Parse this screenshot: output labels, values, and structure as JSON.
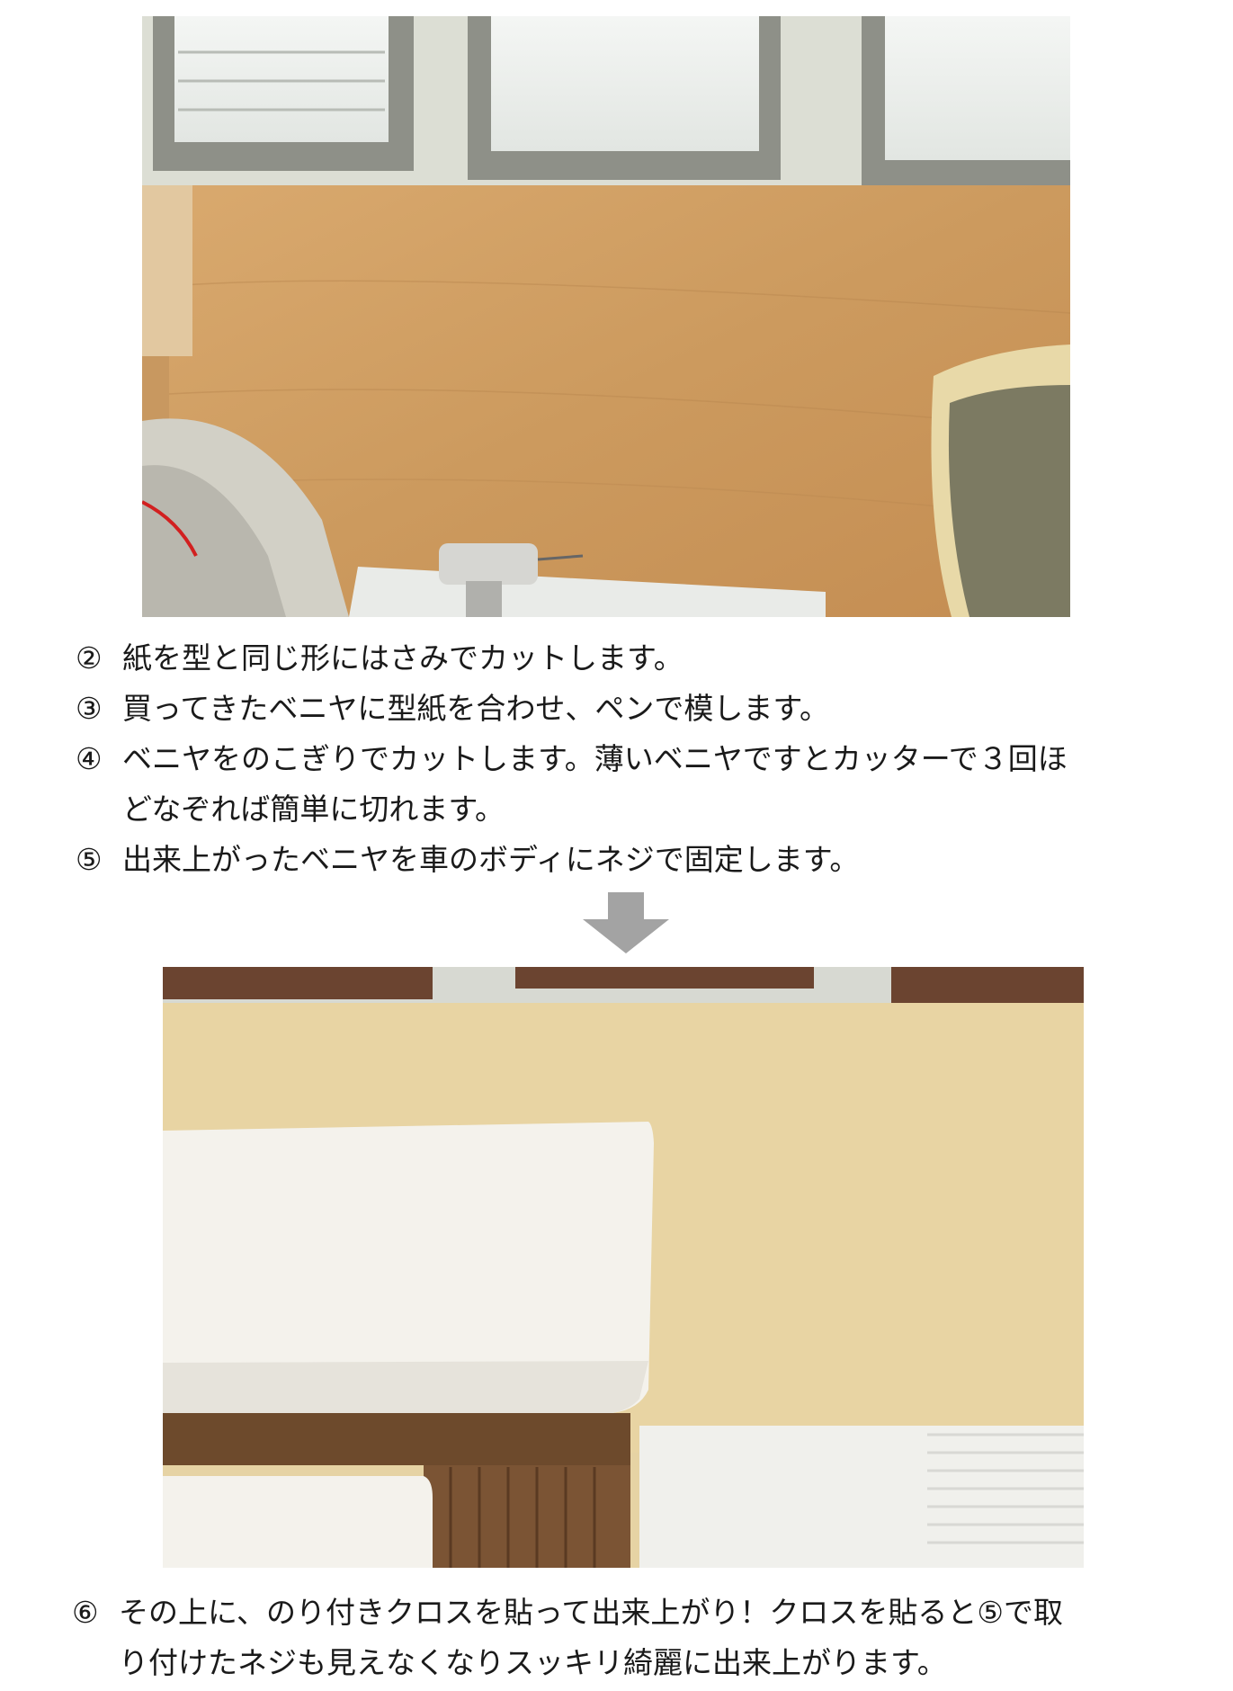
{
  "instructions": {
    "step2": {
      "num": "②",
      "text": "紙を型と同じ形にはさみでカットします。"
    },
    "step3": {
      "num": "③",
      "text": "買ってきたベニヤに型紙を合わせ、ペンで模します。"
    },
    "step4": {
      "num": "④",
      "text": "ベニヤをのこぎりでカットします。薄いベニヤですとカッターで３回ほ",
      "cont": "どなぞれば簡単に切れます。"
    },
    "step5": {
      "num": "⑤",
      "text": "出来上がったベニヤを車のボディにネジで固定します。"
    }
  },
  "result": {
    "step6": {
      "num": "⑥",
      "text": "その上に、のり付きクロスを貼って出来上がり！クロスを貼ると⑤で取",
      "cont": "り付けたネジも見えなくなりスッキリ綺麗に出来上がります。"
    }
  },
  "colors": {
    "arrow": "#a3a3a3",
    "text": "#1a1a1a"
  },
  "icons": {
    "arrow": "arrow-down-icon"
  }
}
